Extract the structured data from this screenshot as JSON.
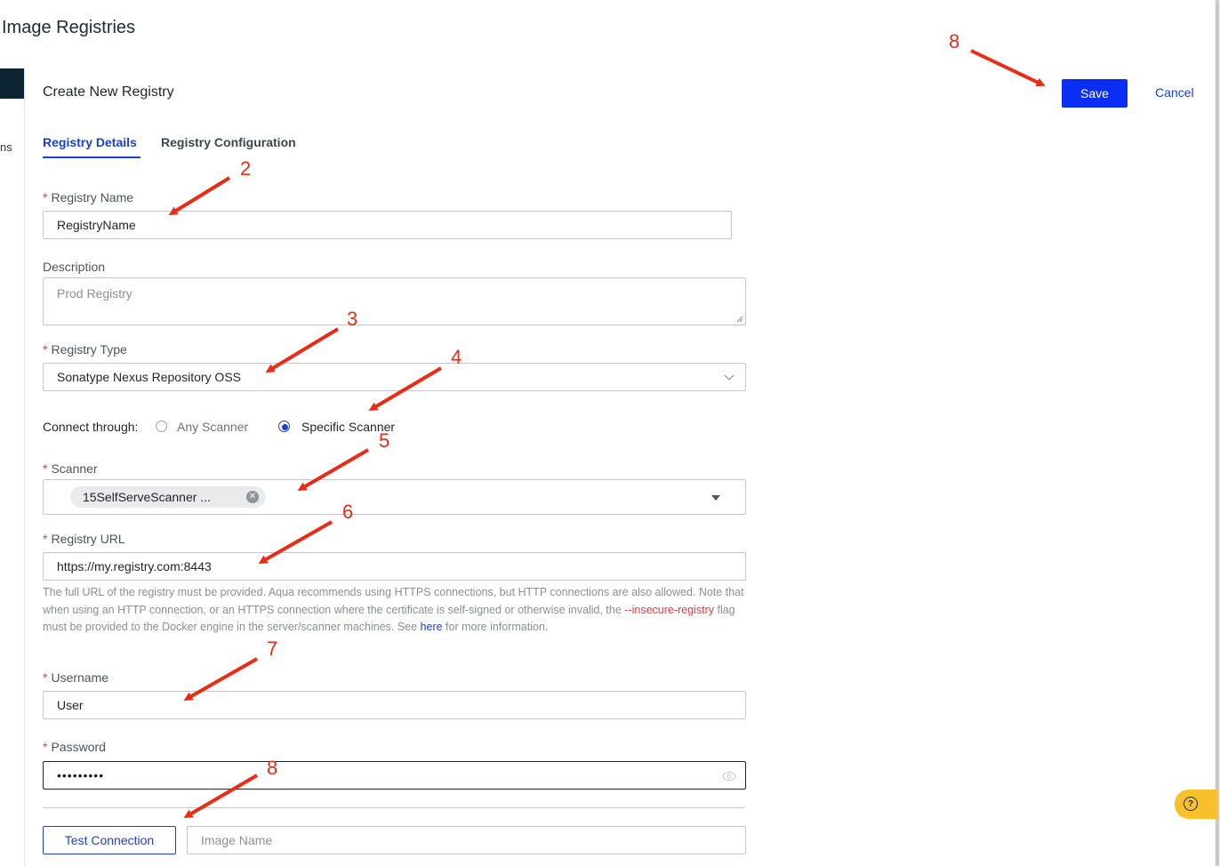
{
  "page": {
    "title": "Image Registries"
  },
  "sidebar": {
    "partial_label": "ns"
  },
  "form": {
    "title": "Create New Registry",
    "save_label": "Save",
    "cancel_label": "Cancel",
    "tabs": [
      {
        "label": "Registry Details",
        "active": true
      },
      {
        "label": "Registry Configuration",
        "active": false
      }
    ],
    "registry_name": {
      "label": "Registry Name",
      "value": "RegistryName"
    },
    "description": {
      "label": "Description",
      "placeholder": "Prod Registry"
    },
    "registry_type": {
      "label": "Registry Type",
      "value": "Sonatype Nexus Repository OSS"
    },
    "connect_through": {
      "label": "Connect through:",
      "options": [
        {
          "label": "Any Scanner",
          "selected": false
        },
        {
          "label": "Specific Scanner",
          "selected": true
        }
      ]
    },
    "scanner": {
      "label": "Scanner",
      "chip": "15SelfServeScanner ..."
    },
    "registry_url": {
      "label": "Registry URL",
      "value": "https://my.registry.com:8443",
      "help_part1": "The full URL of the registry must be provided. Aqua recommends using HTTPS connections, but HTTP connections are also allowed. Note that when using an HTTP connection, or an HTTPS connection where the certificate is self-signed or otherwise invalid, the ",
      "help_flag": "--insecure-registry",
      "help_part2": " flag must be provided to the Docker engine in the server/scanner machines. See ",
      "help_link": "here",
      "help_part3": " for more information."
    },
    "username": {
      "label": "Username",
      "value": "User"
    },
    "password": {
      "label": "Password",
      "value": "•••••••••"
    },
    "test_connection_label": "Test Connection",
    "image_name_placeholder": "Image Name",
    "required_mark": "*"
  },
  "annotations": [
    "8",
    "2",
    "3",
    "4",
    "5",
    "6",
    "7",
    "8"
  ],
  "colors": {
    "primary": "#0b2ef5",
    "link": "#1a3fd1",
    "annotation": "#ea2b16",
    "required": "#e0403a",
    "help_badge": "#f8c12b"
  },
  "icons": {
    "select_arrow": "chevron-down-icon",
    "dropdown_caret": "caret-down-icon",
    "chip_remove": "close-circle-icon",
    "password_toggle": "eye-icon",
    "help": "question-circle-icon"
  }
}
